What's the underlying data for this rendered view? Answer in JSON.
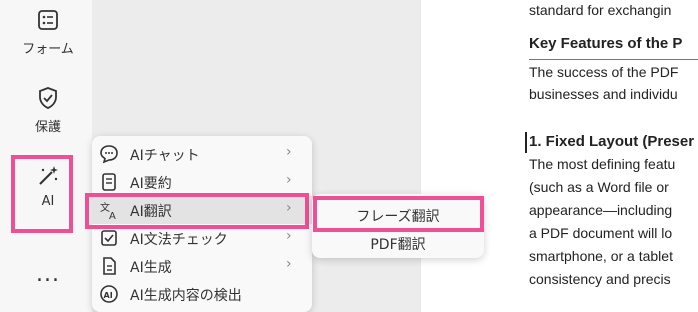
{
  "sidebar": {
    "items": [
      {
        "label": "フォーム",
        "icon": "form-icon"
      },
      {
        "label": "保護",
        "icon": "shield-check-icon"
      },
      {
        "label": "AI",
        "icon": "magic-wand-icon"
      }
    ],
    "more_label": "..."
  },
  "ai_menu": {
    "items": [
      {
        "label": "AIチャット",
        "icon": "chat-bubble-icon",
        "has_submenu": true
      },
      {
        "label": "AI要約",
        "icon": "summary-icon",
        "has_submenu": true
      },
      {
        "label": "AI翻訳",
        "icon": "translate-icon",
        "has_submenu": true,
        "active": true
      },
      {
        "label": "AI文法チェック",
        "icon": "grammar-check-icon",
        "has_submenu": true
      },
      {
        "label": "AI生成",
        "icon": "document-generate-icon",
        "has_submenu": true
      },
      {
        "label": "AI生成内容の検出",
        "icon": "ai-detect-icon",
        "has_submenu": false
      }
    ],
    "chevron": "›"
  },
  "translate_submenu": {
    "items": [
      {
        "label": "フレーズ翻訳"
      },
      {
        "label": "PDF翻訳"
      }
    ]
  },
  "document": {
    "lines": [
      "standard for exchangin",
      "Key Features of the P",
      "The success of the PDF",
      "businesses and individu",
      "1. Fixed Layout (Preser",
      "The most defining featu",
      "(such as a Word file or",
      "appearance—including",
      "a PDF document will lo",
      "smartphone, or a tablet",
      "consistency and precis"
    ]
  },
  "colors": {
    "highlight": "#ee4f95",
    "sidebar_bg": "#f7f7f7",
    "menu_bg": "#f9f9f9",
    "active_bg": "#e3e3e3"
  }
}
